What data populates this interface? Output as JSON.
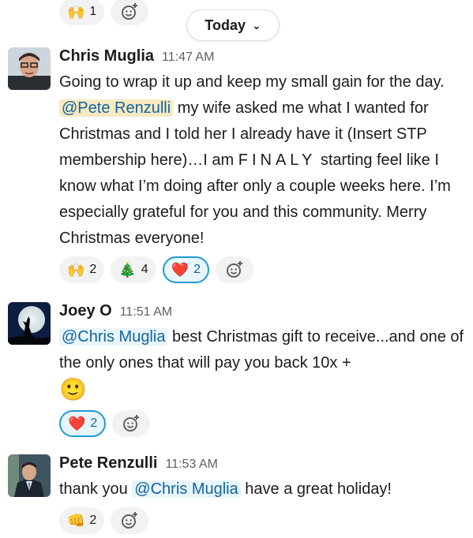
{
  "date_divider": {
    "label": "Today"
  },
  "top_reactions": [
    {
      "emoji": "🙌",
      "count": "1"
    }
  ],
  "messages": [
    {
      "author": "Chris Muglia",
      "time": "11:47 AM",
      "text_1": "Going to wrap it up and keep my small gain for the day. ",
      "mention": "@Pete Renzulli",
      "text_2": " my wife asked me what I wanted for Christmas and I told her I already have it (Insert STP membership here)…I am ",
      "spaced": "FINALY",
      "text_3": " starting feel like I know what I’m doing after only a couple weeks here. I’m especially grateful for you and this community. Merry Christmas everyone!",
      "reactions": [
        {
          "emoji": "🙌",
          "count": "2"
        },
        {
          "emoji": "🎄",
          "count": "4"
        },
        {
          "emoji": "❤️",
          "count": "2"
        }
      ]
    },
    {
      "author": "Joey O",
      "time": "11:51 AM",
      "mention": "@Chris Muglia",
      "text_1": "  best Christmas gift to receive...and one of the only ones that will pay you back 10x + ",
      "emoji": "🙂",
      "reactions": [
        {
          "emoji": "❤️",
          "count": "2"
        }
      ]
    },
    {
      "author": "Pete Renzulli",
      "time": "11:53 AM",
      "text_1": "thank you ",
      "mention": "@Chris Muglia",
      "text_2": " have a great holiday!",
      "reactions": [
        {
          "emoji": "👊",
          "count": "2"
        }
      ]
    }
  ]
}
